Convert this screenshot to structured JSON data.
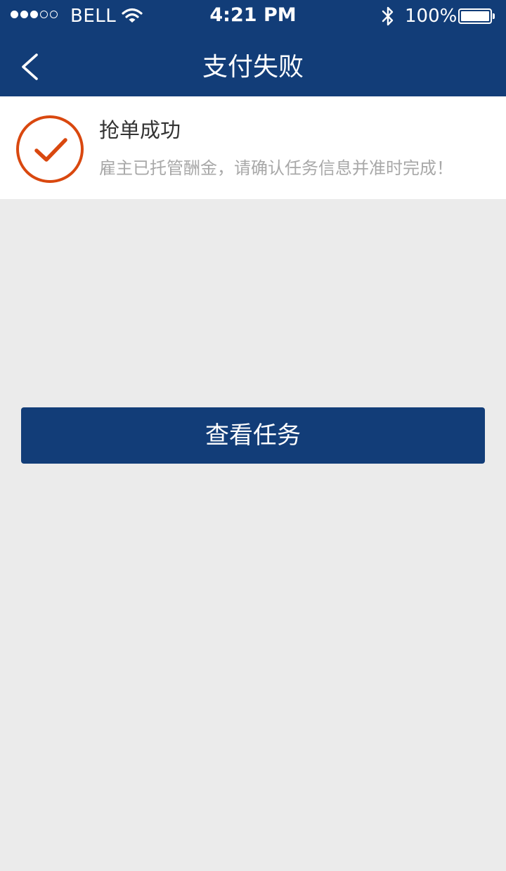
{
  "status_bar": {
    "carrier": "BELL",
    "time": "4:21 PM",
    "battery_percent": "100%",
    "signal_strength": 3,
    "signal_max": 5,
    "battery_level": 1.0,
    "icons": [
      "wifi-icon",
      "bluetooth-icon",
      "battery-icon"
    ]
  },
  "nav": {
    "title": "支付失败",
    "back_icon": "chevron-left-icon"
  },
  "result": {
    "icon": "check-circle-icon",
    "title": "抢单成功",
    "description": "雇主已托管酬金，请确认任务信息并准时完成！"
  },
  "actions": {
    "view_task_label": "查看任务"
  },
  "colors": {
    "primary": "#123d78",
    "success_accent": "#d9480f",
    "background": "#ebebeb",
    "card": "#ffffff",
    "text_dark": "#333333",
    "text_muted": "#a8a8a8"
  }
}
